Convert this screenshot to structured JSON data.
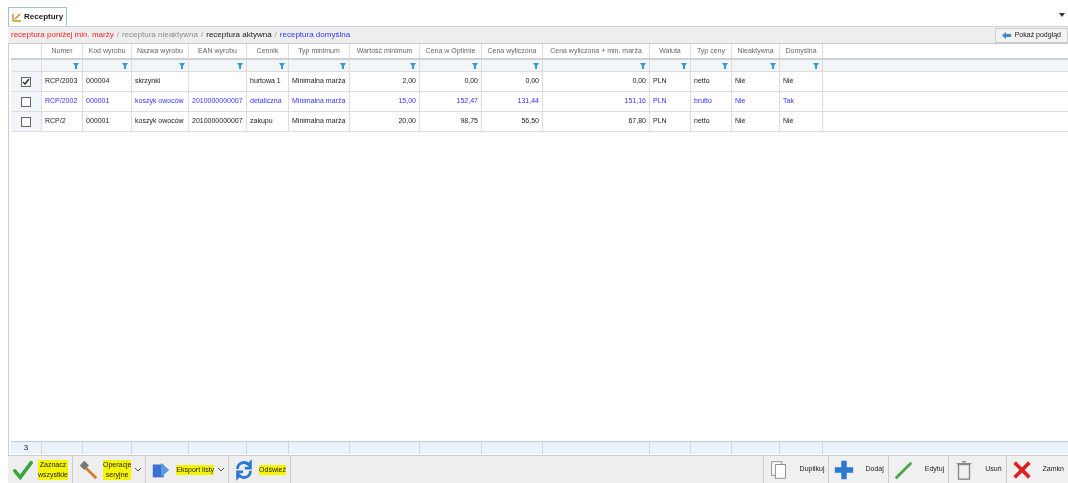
{
  "tabs": [
    {
      "label": "Receptury",
      "selected": true
    }
  ],
  "legend": [
    {
      "label": "receptura poniżej min. marży",
      "kind": "low"
    },
    {
      "separator": "/",
      "label": "receptura nieaktywna",
      "kind": "inactive"
    },
    {
      "separator": "/",
      "label": "receptura aktywna",
      "kind": "active"
    },
    {
      "separator": "/",
      "label": "receptura domyślna",
      "kind": "default"
    }
  ],
  "preview_button": "Pokaż podgląd",
  "table": {
    "columns": [
      {
        "label": "Numer",
        "kind": "text"
      },
      {
        "label": "Kod wyrobu",
        "kind": "text"
      },
      {
        "label": "Nazwa wyrobu",
        "kind": "text"
      },
      {
        "label": "EAN wyrobu",
        "kind": "text"
      },
      {
        "label": "Cennik",
        "kind": "text"
      },
      {
        "label": "Typ minimum",
        "kind": "text"
      },
      {
        "label": "Wartość minimum",
        "kind": "number"
      },
      {
        "label": "Cena w Optimie",
        "kind": "number"
      },
      {
        "label": "Cena wyliczona",
        "kind": "number"
      },
      {
        "label": "Cena wyliczona + min. marża",
        "kind": "number"
      },
      {
        "label": "Waluta",
        "kind": "text"
      },
      {
        "label": "Typ ceny",
        "kind": "text"
      },
      {
        "label": "Nieaktywna",
        "kind": "text"
      },
      {
        "label": "Domyślna",
        "kind": "text"
      }
    ],
    "rows": [
      {
        "checked": true,
        "kind": "active",
        "cells": [
          "RCP/2003",
          "000004",
          "skrzynki",
          "",
          "hurtowa 1",
          "Minimalna marża",
          "2,00",
          "0,00",
          "0,00",
          "0,00",
          "PLN",
          "netto",
          "Nie",
          "Nie"
        ]
      },
      {
        "checked": false,
        "kind": "default",
        "cells": [
          "RCP/2002",
          "000001",
          "koszyk owoców",
          "2010000000007",
          "detaliczna",
          "Minimalna marża",
          "15,00",
          "152,47",
          "131,44",
          "151,16",
          "PLN",
          "brutto",
          "Nie",
          "Tak"
        ]
      },
      {
        "checked": false,
        "kind": "active",
        "cells": [
          "RCP/2",
          "000001",
          "koszyk owoców",
          "2010000000007",
          "zakupu",
          "Minimalna marża",
          "20,00",
          "98,75",
          "56,50",
          "67,80",
          "PLN",
          "netto",
          "Nie",
          "Nie"
        ]
      }
    ],
    "summary_count": "3"
  },
  "toolbar_left": [
    {
      "kind": "check",
      "label": "Zaznacz\nwszystkie",
      "dropdown": false
    },
    {
      "kind": "hammer",
      "label": "Operacje\nseryjne",
      "dropdown": true
    },
    {
      "kind": "export",
      "label": "Eksport listy",
      "dropdown": true
    },
    {
      "kind": "refresh",
      "label": "Odśwież",
      "dropdown": false
    }
  ],
  "toolbar_right": [
    {
      "kind": "copy",
      "label": "Duplikuj"
    },
    {
      "kind": "plus",
      "label": "Dodaj"
    },
    {
      "kind": "pencil",
      "label": "Edytuj"
    },
    {
      "kind": "trash",
      "label": "Usuń"
    },
    {
      "kind": "close",
      "label": "Zamkn"
    }
  ]
}
